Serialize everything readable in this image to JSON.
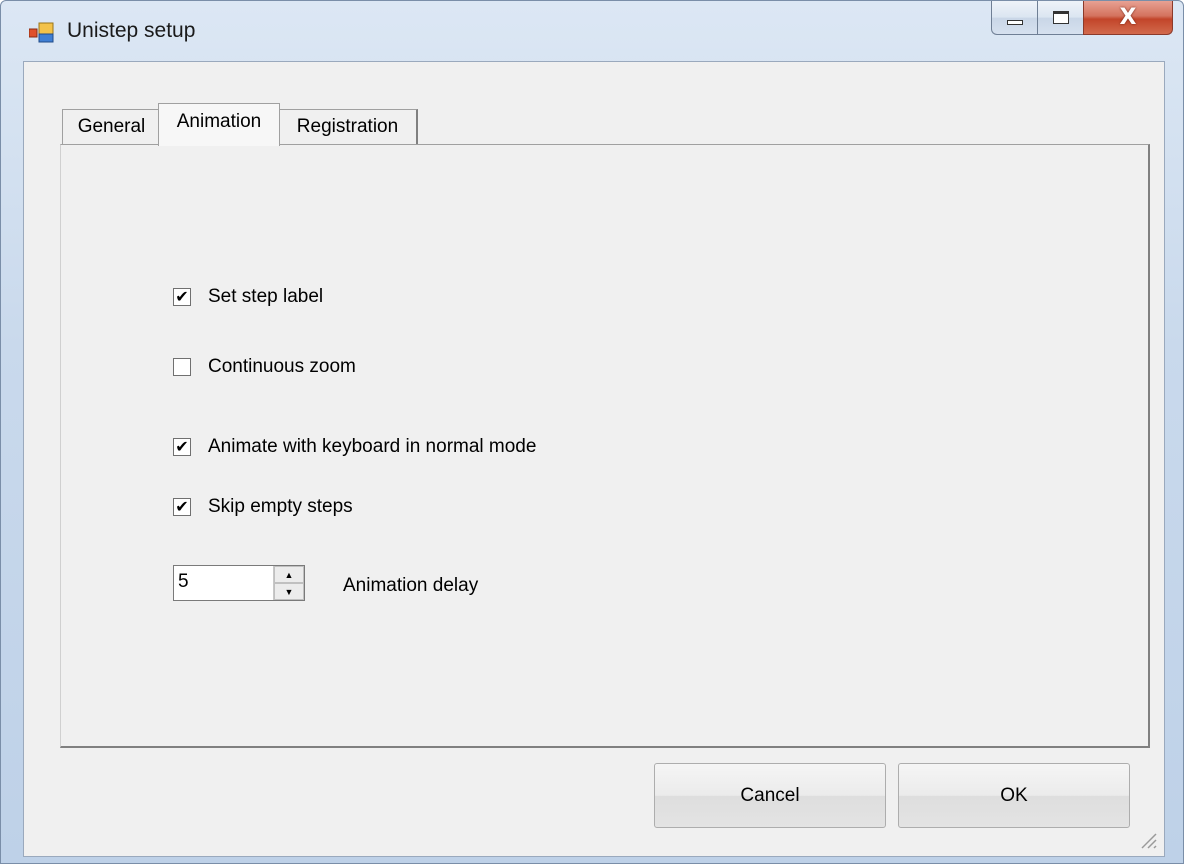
{
  "window": {
    "title": "Unistep setup",
    "icon": "app-icon",
    "caption_buttons": {
      "minimize": "minimize-icon",
      "maximize": "maximize-icon",
      "close": "X"
    }
  },
  "tabs": [
    {
      "label": "General",
      "selected": false
    },
    {
      "label": "Animation",
      "selected": true
    },
    {
      "label": "Registration",
      "selected": false
    }
  ],
  "animation_panel": {
    "options": [
      {
        "label": "Set step label",
        "checked": true
      },
      {
        "label": "Continuous zoom",
        "checked": false
      },
      {
        "label": "Animate with keyboard in normal mode",
        "checked": true
      },
      {
        "label": "Skip empty steps",
        "checked": true
      }
    ],
    "delay": {
      "value": "5",
      "label": "Animation delay"
    }
  },
  "buttons": {
    "cancel": "Cancel",
    "ok": "OK"
  },
  "colors": {
    "titlebar": "#c9d9ec",
    "client": "#f0f0f0",
    "close_button": "#c2452a"
  }
}
